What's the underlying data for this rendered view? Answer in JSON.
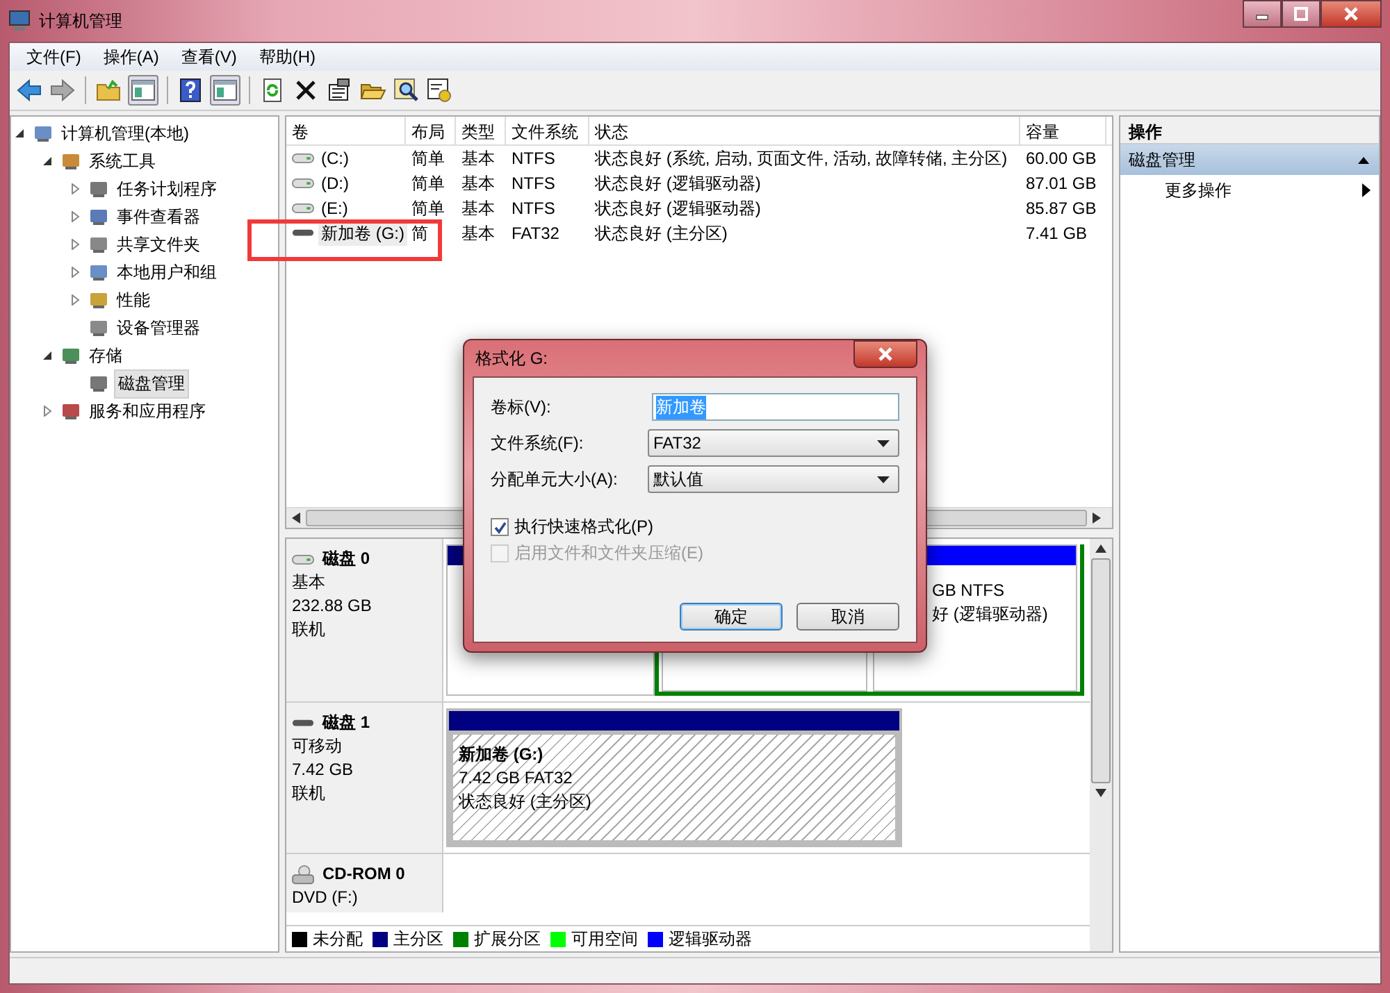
{
  "window": {
    "title": "计算机管理"
  },
  "menu": [
    "文件(F)",
    "操作(A)",
    "查看(V)",
    "帮助(H)"
  ],
  "tree": [
    {
      "label": "计算机管理(本地)",
      "selected": false,
      "expanded": true,
      "children": [
        {
          "label": "系统工具",
          "selected": false,
          "expanded": true,
          "children": [
            {
              "label": "任务计划程序",
              "selected": false,
              "expanded": false
            },
            {
              "label": "事件查看器",
              "selected": false,
              "expanded": false
            },
            {
              "label": "共享文件夹",
              "selected": false,
              "expanded": false
            },
            {
              "label": "本地用户和组",
              "selected": false,
              "expanded": false
            },
            {
              "label": "性能",
              "selected": false,
              "expanded": false
            },
            {
              "label": "设备管理器",
              "selected": false
            }
          ]
        },
        {
          "label": "存储",
          "selected": false,
          "expanded": true,
          "children": [
            {
              "label": "磁盘管理",
              "selected": true
            }
          ]
        },
        {
          "label": "服务和应用程序",
          "selected": false,
          "expanded": false
        }
      ]
    }
  ],
  "table": {
    "columns": [
      "卷",
      "布局",
      "类型",
      "文件系统",
      "状态",
      "容量"
    ],
    "rows": [
      {
        "cells": [
          "(C:)",
          "简单",
          "基本",
          "NTFS",
          "状态良好 (系统, 启动, 页面文件, 活动, 故障转储, 主分区)",
          "60.00 GB"
        ],
        "selected": false,
        "kind": "fixed"
      },
      {
        "cells": [
          "(D:)",
          "简单",
          "基本",
          "NTFS",
          "状态良好 (逻辑驱动器)",
          "87.01 GB"
        ],
        "selected": false,
        "kind": "fixed"
      },
      {
        "cells": [
          "(E:)",
          "简单",
          "基本",
          "NTFS",
          "状态良好 (逻辑驱动器)",
          "85.87 GB"
        ],
        "selected": false,
        "kind": "fixed"
      },
      {
        "cells": [
          "新加卷 (G:)",
          "简",
          "基本",
          "FAT32",
          "状态良好 (主分区)",
          "7.41 GB"
        ],
        "selected": true,
        "kind": "removable"
      }
    ]
  },
  "disks": [
    {
      "kind": "fixed",
      "name": "磁盘 0",
      "lines": [
        "基本",
        "232.88 GB",
        "联机"
      ],
      "partitions": [
        {
          "kind": "primary",
          "color": "#000080",
          "selected": false
        },
        {
          "kind": "extended",
          "color": "#008000",
          "children": [
            {
              "kind": "logical",
              "selected": false
            },
            {
              "kind": "logical",
              "color": "#0000ff",
              "selected": false,
              "lines": [
                "GB NTFS",
                "好 (逻辑驱动器)"
              ]
            }
          ]
        }
      ]
    },
    {
      "kind": "removable",
      "name": "磁盘 1",
      "lines": [
        "可移动",
        "7.42 GB",
        "联机"
      ],
      "partitions": [
        {
          "kind": "primary",
          "color": "#000080",
          "selected": true,
          "title": "新加卷  (G:)",
          "lines": [
            "7.42 GB FAT32",
            "状态良好 (主分区)"
          ]
        }
      ]
    },
    {
      "kind": "cdrom",
      "name": "CD-ROM 0",
      "lines": [
        "DVD (F:)"
      ]
    }
  ],
  "legend": [
    {
      "label": "未分配",
      "color": "#000000"
    },
    {
      "label": "主分区",
      "color": "#000080"
    },
    {
      "label": "扩展分区",
      "color": "#008000"
    },
    {
      "label": "可用空间",
      "color": "#00ff00"
    },
    {
      "label": "逻辑驱动器",
      "color": "#0000ff"
    }
  ],
  "actions": {
    "title": "操作",
    "section": "磁盘管理",
    "expanded": true,
    "items": [
      "更多操作"
    ]
  },
  "dialog": {
    "title": "格式化 G:",
    "fields": [
      {
        "kind": "text",
        "label": "卷标(V):",
        "value": "新加卷"
      },
      {
        "kind": "select",
        "label": "文件系统(F):",
        "value": "FAT32"
      },
      {
        "kind": "select",
        "label": "分配单元大小(A):",
        "value": "默认值"
      }
    ],
    "checkboxes": [
      {
        "label": "执行快速格式化(P)",
        "checked": true,
        "disabled": false
      },
      {
        "label": "启用文件和文件夹压缩(E)",
        "checked": false,
        "disabled": true
      }
    ],
    "buttons": [
      {
        "label": "确定",
        "default": true
      },
      {
        "label": "取消",
        "default": false
      }
    ]
  }
}
